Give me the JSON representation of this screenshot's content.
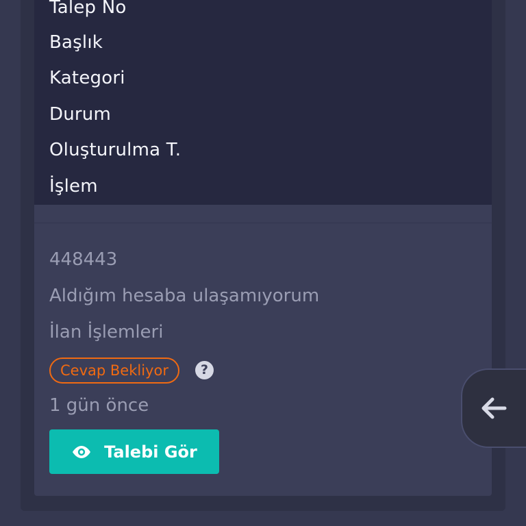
{
  "table": {
    "headers": {
      "ticket_no": "Talep No",
      "title": "Başlık",
      "category": "Kategori",
      "status": "Durum",
      "created_at": "Oluşturulma T.",
      "action": "İşlem"
    },
    "row": {
      "ticket_no": "448443",
      "title": "Aldığım hesaba ulaşamıyorum",
      "category": "İlan İşlemleri",
      "status": "Cevap Bekliyor",
      "created_at": "1 gün önce",
      "action_label": "Talebi Gör"
    }
  },
  "icons": {
    "help": "question-circle-icon",
    "view": "eye-icon",
    "back": "arrow-left-icon"
  },
  "colors": {
    "status_pending": "#f06a12",
    "primary_button": "#0cbcb0",
    "header_background": "#262840",
    "card_background": "#3b3e58"
  }
}
